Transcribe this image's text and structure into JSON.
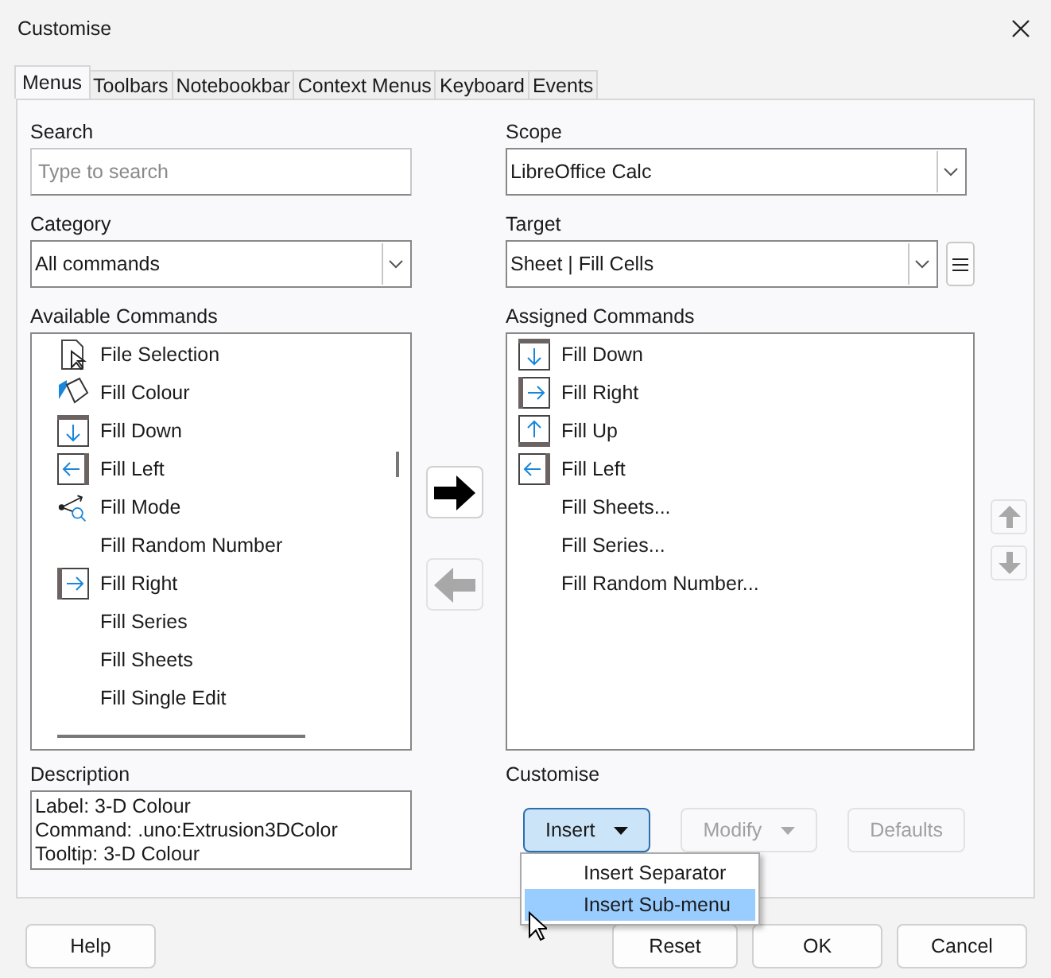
{
  "window": {
    "title": "Customise"
  },
  "tabs": [
    {
      "label": "Menus",
      "selected": true
    },
    {
      "label": "Toolbars",
      "selected": false
    },
    {
      "label": "Notebookbar",
      "selected": false
    },
    {
      "label": "Context Menus",
      "selected": false
    },
    {
      "label": "Keyboard",
      "selected": false
    },
    {
      "label": "Events",
      "selected": false
    }
  ],
  "search": {
    "label": "Search",
    "placeholder": "Type to search"
  },
  "category": {
    "label": "Category",
    "value": "All commands"
  },
  "scope": {
    "label": "Scope",
    "value": "LibreOffice Calc"
  },
  "target": {
    "label": "Target",
    "value": "Sheet | Fill Cells"
  },
  "available_commands": {
    "label": "Available Commands",
    "items": [
      {
        "label": "File Selection",
        "kind": "file-selection"
      },
      {
        "label": "Fill Colour",
        "kind": "fill-colour"
      },
      {
        "label": "Fill Down",
        "kind": "down"
      },
      {
        "label": "Fill Left",
        "kind": "left"
      },
      {
        "label": "Fill Mode",
        "kind": "fill-mode"
      },
      {
        "label": "Fill Random Number",
        "kind": "plain"
      },
      {
        "label": "Fill Right",
        "kind": "right"
      },
      {
        "label": "Fill Series",
        "kind": "plain"
      },
      {
        "label": "Fill Sheets",
        "kind": "plain"
      },
      {
        "label": "Fill Single Edit",
        "kind": "plain"
      }
    ]
  },
  "assigned_commands": {
    "label": "Assigned Commands",
    "items": [
      {
        "label": "Fill Down",
        "kind": "down"
      },
      {
        "label": "Fill Right",
        "kind": "right"
      },
      {
        "label": "Fill Up",
        "kind": "up"
      },
      {
        "label": "Fill Left",
        "kind": "left"
      },
      {
        "label": "Fill Sheets...",
        "kind": "plain"
      },
      {
        "label": "Fill Series...",
        "kind": "plain"
      },
      {
        "label": "Fill Random Number...",
        "kind": "plain"
      }
    ]
  },
  "add_button": {
    "disabled": false
  },
  "remove_button": {
    "disabled": true
  },
  "move_buttons": [
    {
      "kind": "up",
      "disabled": true
    },
    {
      "kind": "down",
      "disabled": true
    }
  ],
  "description": {
    "label": "Description",
    "lines": [
      "Label: 3-D Colour",
      "Command: .uno:Extrusion3DColor",
      "Tooltip: 3-D Colour"
    ]
  },
  "customise": {
    "label": "Customise",
    "buttons": [
      {
        "label": "Insert",
        "disabled": false,
        "dropdown": true,
        "pressed": true
      },
      {
        "label": "Modify",
        "disabled": true,
        "dropdown": true,
        "pressed": false
      },
      {
        "label": "Defaults",
        "disabled": true,
        "dropdown": false,
        "pressed": false
      }
    ]
  },
  "insert_menu": {
    "items": [
      {
        "label": "Insert Separator",
        "selected": false
      },
      {
        "label": "Insert Sub-menu",
        "selected": true
      }
    ]
  },
  "footer_buttons": [
    {
      "label": "Help",
      "kind": "left"
    },
    {
      "label": "Reset",
      "kind": "right"
    },
    {
      "label": "OK",
      "kind": "right"
    },
    {
      "label": "Cancel",
      "kind": "right"
    }
  ]
}
